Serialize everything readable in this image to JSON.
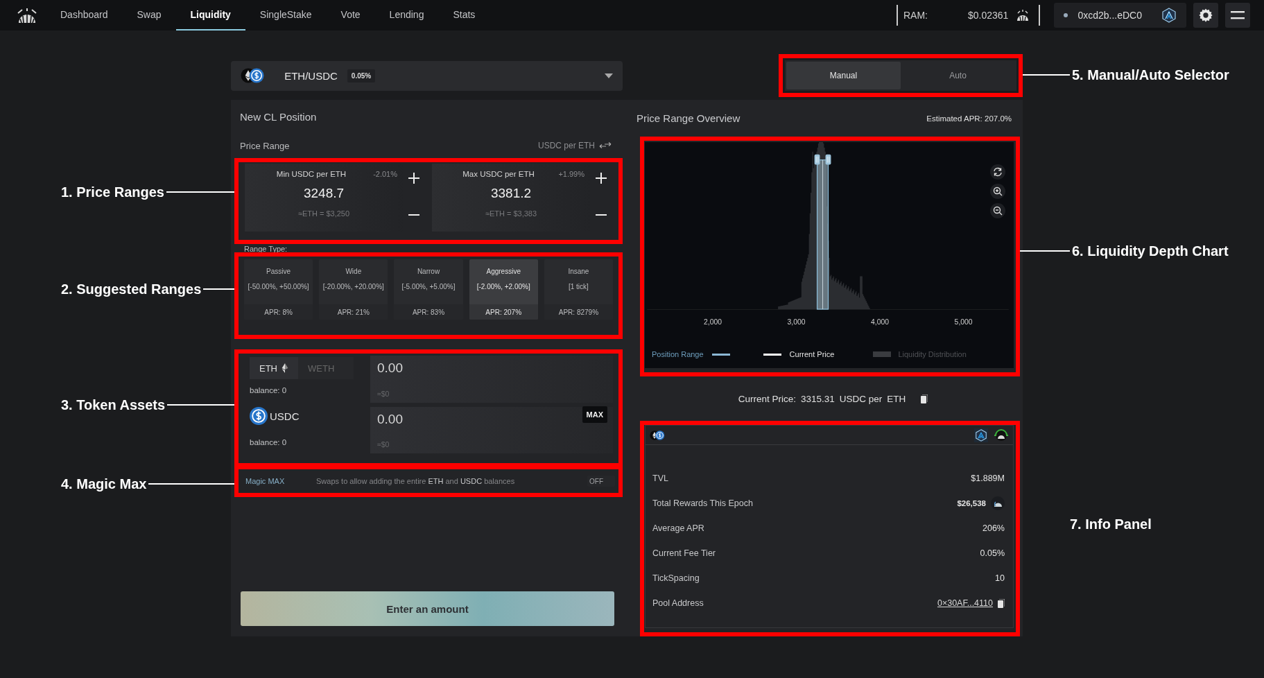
{
  "nav": {
    "items": [
      {
        "label": "Dashboard",
        "selected": false
      },
      {
        "label": "Swap",
        "selected": false
      },
      {
        "label": "Liquidity",
        "selected": true
      },
      {
        "label": "SingleStake",
        "selected": false
      },
      {
        "label": "Vote",
        "selected": false
      },
      {
        "label": "Lending",
        "selected": false
      },
      {
        "label": "Stats",
        "selected": false
      }
    ],
    "ram_label": "RAM:",
    "ram_price": "$0.02361",
    "wallet": "0xcd2b...eDC0"
  },
  "pool": {
    "pair": "ETH/USDC",
    "fee": "0.05%"
  },
  "mode_tabs": [
    {
      "label": "Manual",
      "selected": true
    },
    {
      "label": "Auto",
      "selected": false
    }
  ],
  "position": {
    "title": "New CL Position",
    "price_range_label": "Price Range",
    "unit_toggle": "USDC per ETH",
    "bounds": [
      {
        "label": "Min USDC per ETH",
        "change": "-2.01%",
        "value": "3248.7",
        "usd": "≈ETH = $3,250"
      },
      {
        "label": "Max USDC per ETH",
        "change": "+1.99%",
        "value": "3381.2",
        "usd": "≈ETH = $3,383"
      }
    ],
    "range_type_label": "Range Type:",
    "range_types": [
      {
        "name": "Passive",
        "range": "[-50.00%, +50.00%]",
        "apr": "APR: 8%",
        "selected": false
      },
      {
        "name": "Wide",
        "range": "[-20.00%, +20.00%]",
        "apr": "APR: 21%",
        "selected": false
      },
      {
        "name": "Narrow",
        "range": "[-5.00%, +5.00%]",
        "apr": "APR: 83%",
        "selected": false
      },
      {
        "name": "Aggressive",
        "range": "[-2.00%, +2.00%]",
        "apr": "APR: 207%",
        "selected": true
      },
      {
        "name": "Insane",
        "range": "[1 tick]",
        "apr": "APR: 8279%",
        "selected": false
      }
    ],
    "tokens": [
      {
        "kind": "toggle",
        "options": [
          {
            "label": "ETH",
            "selected": true
          },
          {
            "label": "WETH",
            "selected": false
          }
        ],
        "balance": "balance: 0",
        "amount": "0.00",
        "usd": "≈$0"
      },
      {
        "kind": "single",
        "name": "USDC",
        "balance": "balance: 0",
        "amount": "0.00",
        "usd": "≈$0"
      }
    ],
    "max_button": "MAX",
    "magic_max": {
      "label": "Magic MAX",
      "description": "Swaps to allow adding the entire **ETH** and **USDC** balances",
      "on": false,
      "state_label": "OFF"
    },
    "submit": "Enter an amount"
  },
  "overview": {
    "title": "Price Range Overview",
    "estimated_apr": "Estimated APR: 207.0%",
    "x_ticks": [
      "2,000",
      "3,000",
      "4,000",
      "5,000"
    ],
    "legend": [
      "Position Range",
      "Current Price",
      "Liquidity Distribution"
    ],
    "current_price": {
      "label": "Current Price:",
      "value": "3315.31",
      "unit": "USDC per",
      "token": "ETH"
    }
  },
  "info": {
    "rows": [
      {
        "kind": "plain",
        "label": "TVL",
        "value": "$1.889M"
      },
      {
        "kind": "reward",
        "label": "Total Rewards This Epoch",
        "value": "$26,538"
      },
      {
        "kind": "plain",
        "label": "Average APR",
        "value": "206%"
      },
      {
        "kind": "plain",
        "label": "Current Fee Tier",
        "value": "0.05%"
      },
      {
        "kind": "plain",
        "label": "TickSpacing",
        "value": "10"
      },
      {
        "kind": "link",
        "label": "Pool Address",
        "value": "0×30AF...4110"
      }
    ]
  },
  "annotations": [
    {
      "label": "1. Price Ranges"
    },
    {
      "label": "2. Suggested Ranges"
    },
    {
      "label": "3. Token Assets"
    },
    {
      "label": "4. Magic Max"
    },
    {
      "label": "5. Manual/Auto Selector"
    },
    {
      "label": "6. Liquidity Depth Chart"
    },
    {
      "label": "7. Info Panel"
    }
  ]
}
